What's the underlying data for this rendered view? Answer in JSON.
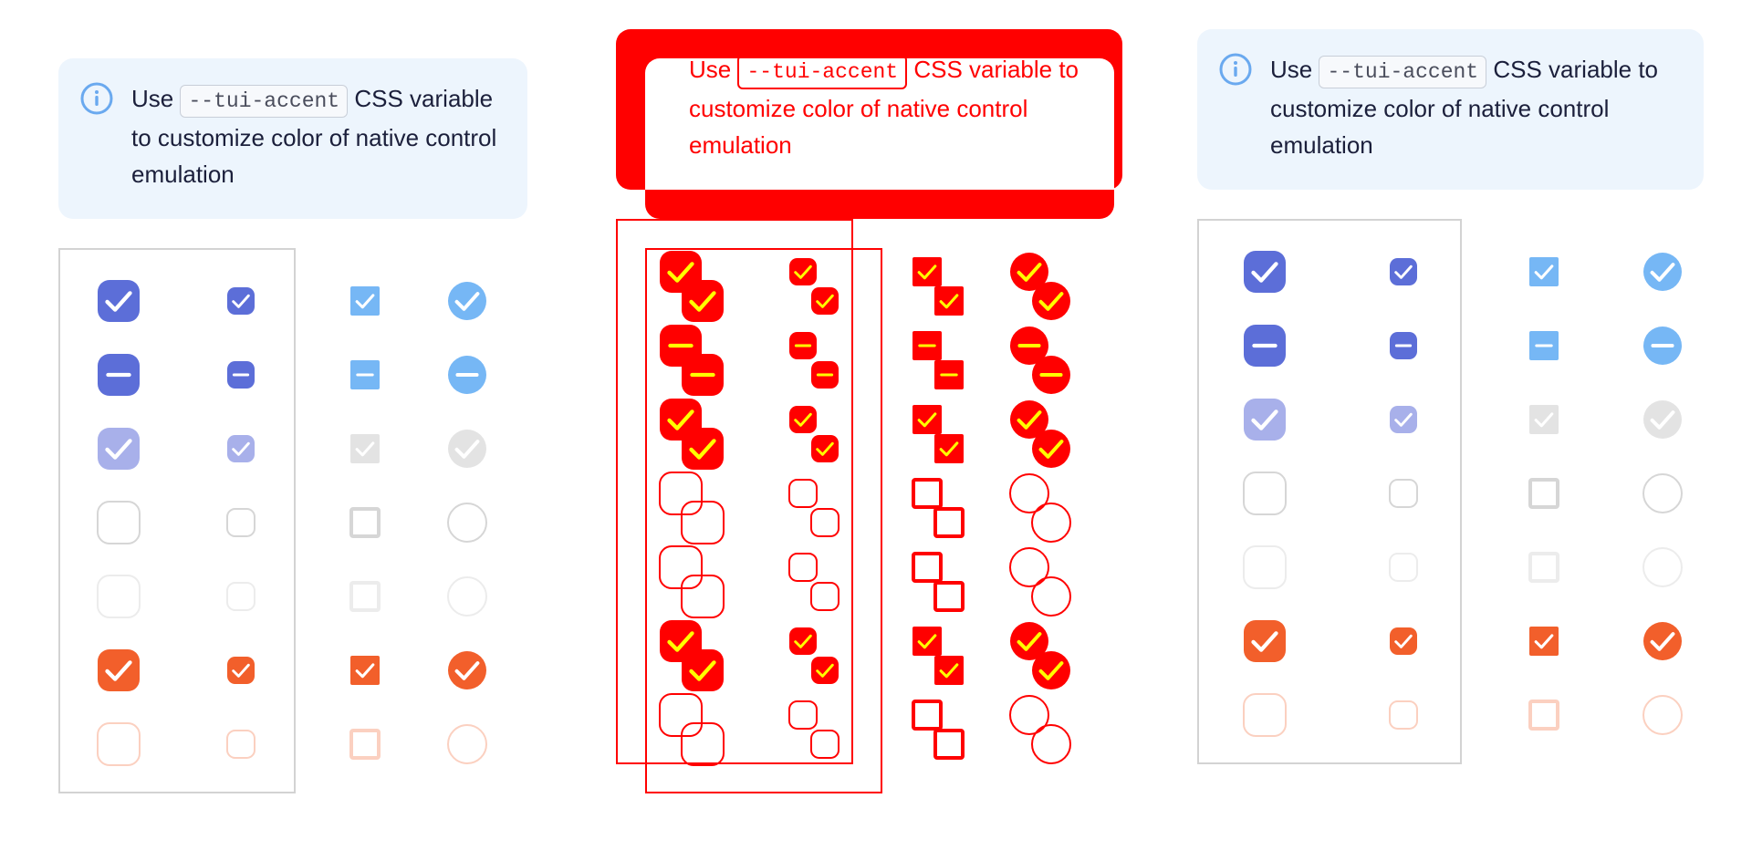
{
  "notice": {
    "prefix": "Use",
    "code": "--tui-accent",
    "suffix": "CSS variable to customize color of native control emulation"
  },
  "colors": {
    "primary": "#5c6ed8",
    "primary_dim": "#a8b0ea",
    "blue": "#76b7f5",
    "blue_dim": "#e3e3e3",
    "error": "#f25f2b",
    "error_dim": "#fcd7c8",
    "border": "#d3d3d3",
    "notice_bg": "#edf5fd",
    "diff_red": "#ff0000",
    "diff_yellow": "#ffff00"
  },
  "columns": [
    "checkbox-large",
    "checkbox-small",
    "native-checkbox",
    "native-radio"
  ],
  "rows": [
    {
      "state": "checked",
      "tone": "primary"
    },
    {
      "state": "indeterminate",
      "tone": "primary"
    },
    {
      "state": "checked",
      "tone": "primary-disabled"
    },
    {
      "state": "unchecked",
      "tone": "default"
    },
    {
      "state": "unchecked",
      "tone": "default-disabled"
    },
    {
      "state": "checked",
      "tone": "error"
    },
    {
      "state": "unchecked",
      "tone": "error-disabled"
    }
  ]
}
